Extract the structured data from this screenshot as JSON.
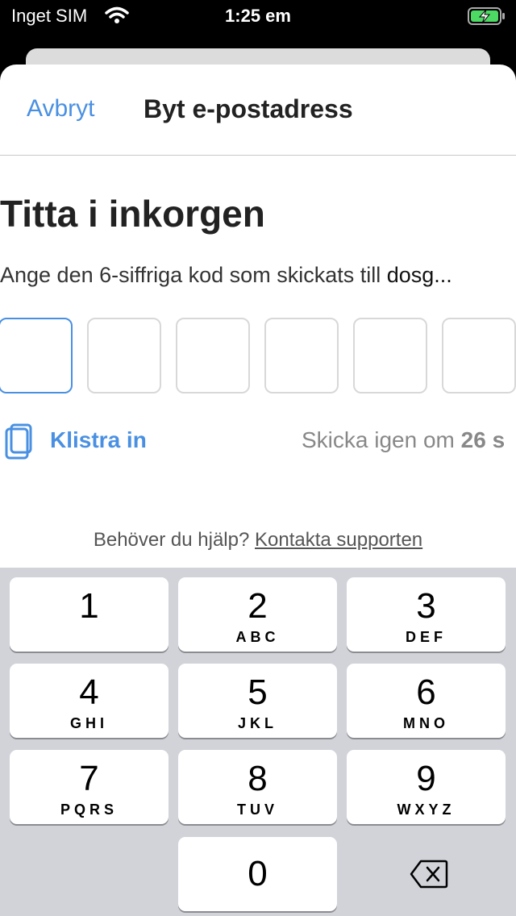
{
  "status_bar": {
    "carrier": "Inget SIM",
    "time": "1:25 em"
  },
  "nav": {
    "cancel_label": "Avbryt",
    "title": "Byt e-postadress"
  },
  "content": {
    "heading": "Titta i inkorgen",
    "subtitle_prefix": "Ange den 6-siffriga kod som skickats till ",
    "subtitle_email": "dosg...",
    "code_boxes": [
      "",
      "",
      "",
      "",
      "",
      ""
    ],
    "paste_label": "Klistra in",
    "resend_prefix": "Skicka igen om ",
    "resend_countdown": "26 s"
  },
  "help": {
    "text": "Behöver du hjälp? ",
    "link": "Kontakta supporten"
  },
  "keypad": {
    "keys": [
      {
        "num": "1",
        "letters": ""
      },
      {
        "num": "2",
        "letters": "ABC"
      },
      {
        "num": "3",
        "letters": "DEF"
      },
      {
        "num": "4",
        "letters": "GHI"
      },
      {
        "num": "5",
        "letters": "JKL"
      },
      {
        "num": "6",
        "letters": "MNO"
      },
      {
        "num": "7",
        "letters": "PQRS"
      },
      {
        "num": "8",
        "letters": "TUV"
      },
      {
        "num": "9",
        "letters": "WXYZ"
      },
      {
        "num": "0",
        "letters": ""
      }
    ]
  },
  "colors": {
    "accent": "#4a90e2",
    "battery_fill": "#4cd964",
    "keypad_bg": "#d1d3d9"
  },
  "icons": [
    "wifi-icon",
    "battery-charging-icon",
    "clipboard-icon",
    "backspace-icon"
  ]
}
